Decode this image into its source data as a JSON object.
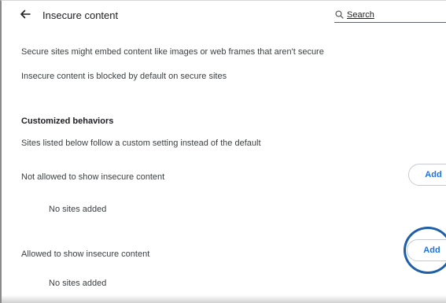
{
  "header": {
    "title": "Insecure content",
    "search_placeholder": "Search",
    "back_icon": "arrow-back-icon",
    "search_icon": "search-icon"
  },
  "intro": {
    "line1": "Secure sites might embed content like images or web frames that aren't secure",
    "line2": "Insecure content is blocked by default on secure sites"
  },
  "customized": {
    "heading": "Customized behaviors",
    "description": "Sites listed below follow a custom setting instead of the default"
  },
  "not_allowed": {
    "label": "Not allowed to show insecure content",
    "add_label": "Add",
    "empty_text": "No sites added"
  },
  "allowed": {
    "label": "Allowed to show insecure content",
    "add_label": "Add",
    "empty_text": "No sites added"
  },
  "colors": {
    "accent": "#1a73e8",
    "highlight_ring": "#1e5fa8",
    "text": "#3c4043"
  }
}
